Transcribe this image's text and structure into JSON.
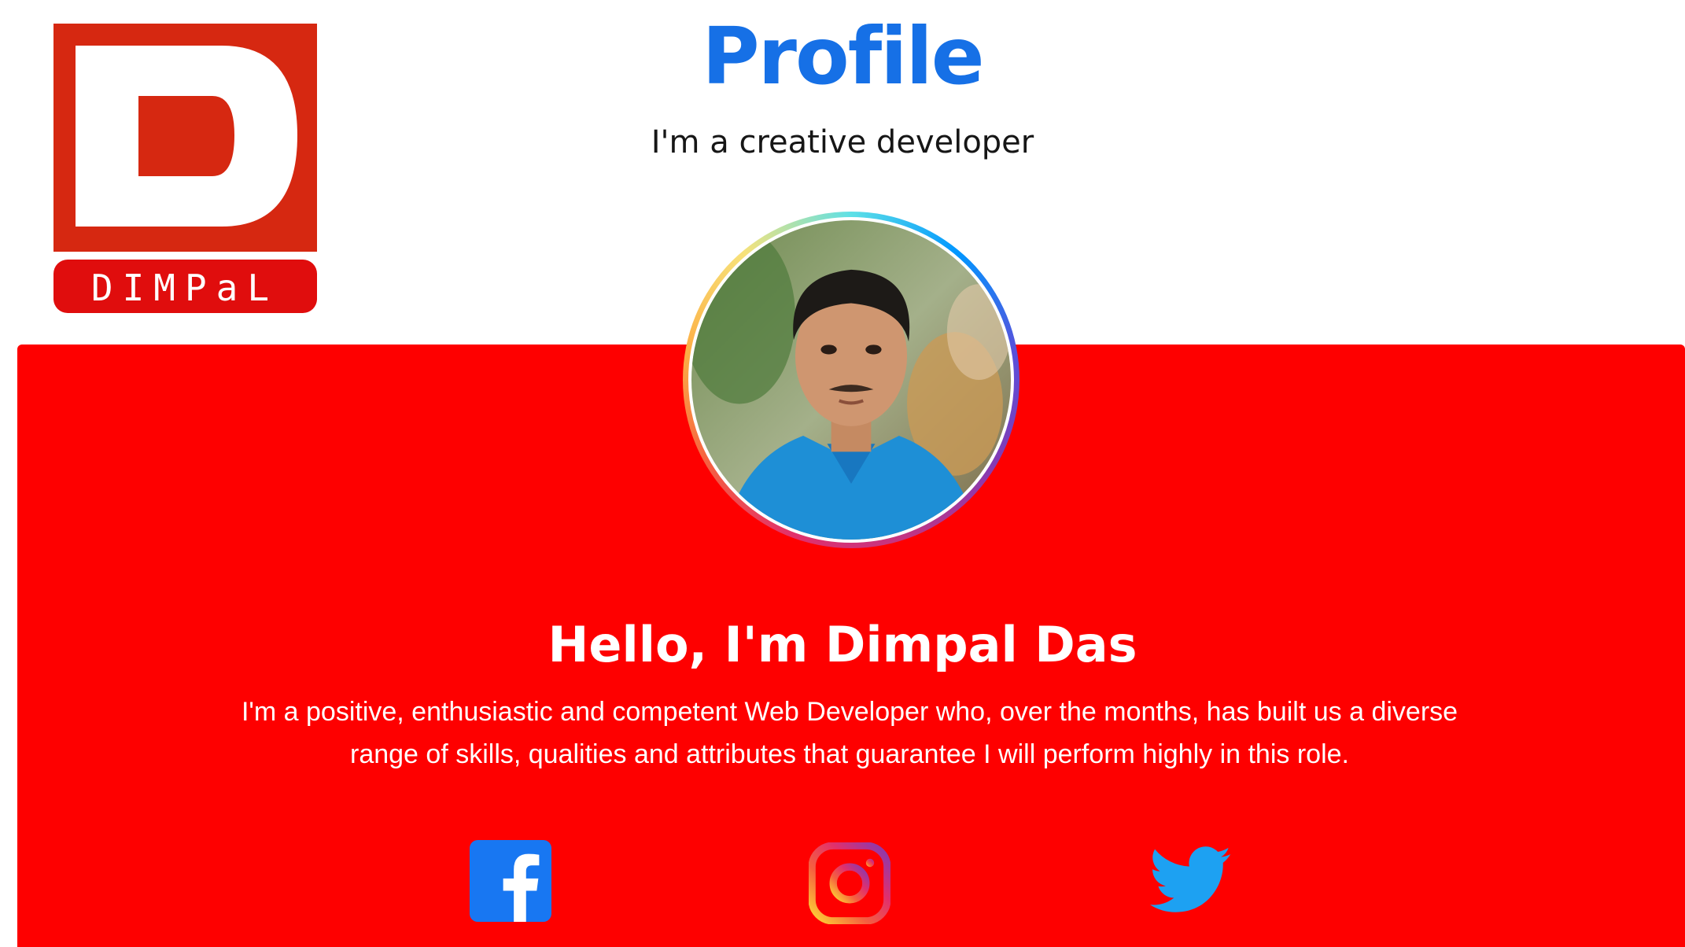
{
  "logo": {
    "letter": "D",
    "wordmark": "DIMPaL",
    "colors": {
      "primary": "#d62811",
      "text": "#ffffff"
    }
  },
  "header": {
    "title": "Profile",
    "subtitle": "I'm a creative developer"
  },
  "profile": {
    "avatar_icon": "profile-photo",
    "greeting": "Hello, I'm Dimpal Das",
    "bio": "I'm a positive, enthusiastic and competent Web Developer who, over the months, has built us a diverse range of skills, qualities and attributes that guarantee I will perform highly in this role."
  },
  "social": [
    {
      "name": "facebook",
      "icon": "facebook-icon",
      "color": "#1877f2"
    },
    {
      "name": "instagram",
      "icon": "instagram-icon",
      "color": "#e1306c"
    },
    {
      "name": "twitter",
      "icon": "twitter-icon",
      "color": "#1da1f2"
    }
  ],
  "colors": {
    "title": "#1670e6",
    "card": "#fe0000",
    "card_text": "#ffffff",
    "subtitle": "#161616"
  }
}
